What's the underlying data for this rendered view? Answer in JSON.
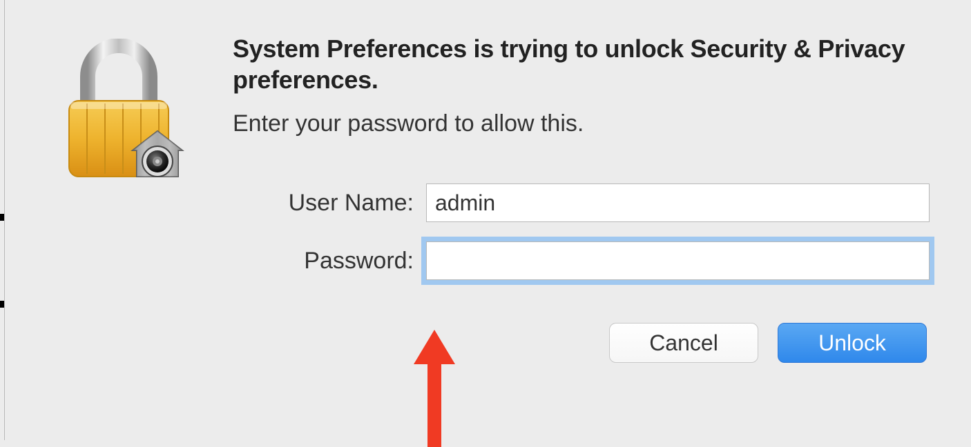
{
  "dialog": {
    "headline": "System Preferences is trying to unlock Security & Privacy preferences.",
    "subline": "Enter your password to allow this.",
    "icon": "locked-padlock-with-vault-badge-icon"
  },
  "form": {
    "username_label": "User Name:",
    "username_value": "admin",
    "password_label": "Password:",
    "password_value": ""
  },
  "buttons": {
    "cancel": "Cancel",
    "confirm": "Unlock"
  }
}
